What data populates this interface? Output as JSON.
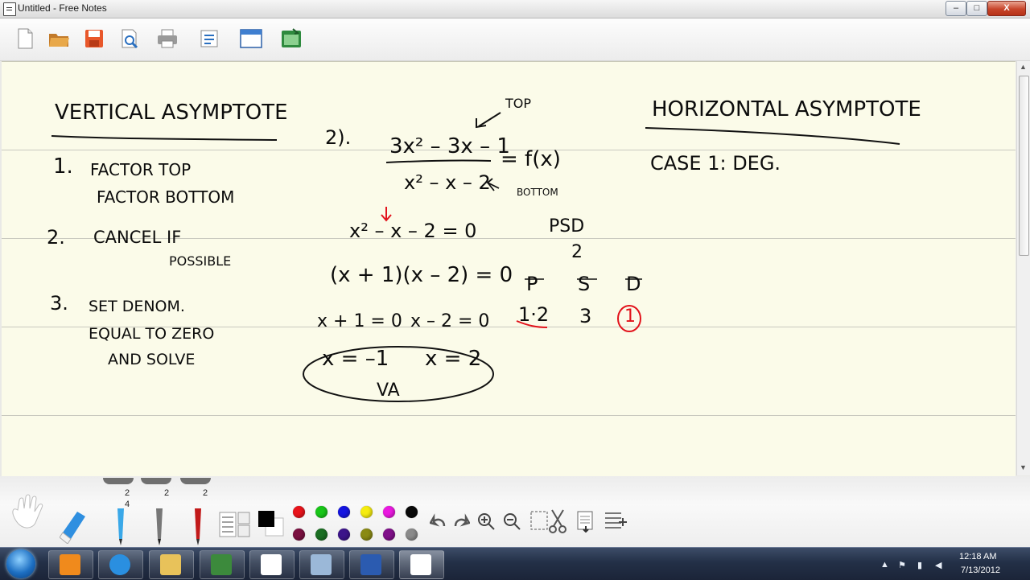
{
  "window": {
    "title": "Untitled - Free Notes",
    "controls": {
      "minimize": "–",
      "maximize": "□",
      "close": "X"
    }
  },
  "toolbar": {
    "buttons": [
      "new-document-icon",
      "open-folder-icon",
      "save-icon",
      "print-preview-icon",
      "print-icon",
      "page-setup-icon",
      "window-icon",
      "export-image-icon"
    ]
  },
  "notes": {
    "vertical": {
      "heading": "VERTICAL ASYMPTOTE",
      "step1_num": "1.",
      "step1_a": "FACTOR TOP",
      "step1_b": "FACTOR BOTTOM",
      "step2_num": "2.",
      "step2_a": "CANCEL IF",
      "step2_b": "POSSIBLE",
      "step3_num": "3.",
      "step3_a": "SET DENOM.",
      "step3_b": "EQUAL TO ZERO",
      "step3_c": "AND SOLVE"
    },
    "example": {
      "label": "2).",
      "numerator": "3x² – 3x – 1",
      "fx": "= f(x)",
      "denominator": "x² – x – 2",
      "top_label": "TOP",
      "bottom_label": "BOTTOM",
      "eq_set": "x² – x – 2 = 0",
      "factored": "(x + 1)(x – 2) = 0",
      "eq1": "x + 1 = 0",
      "eq2": "x – 2 = 0",
      "root1": "x = –1",
      "root2": "x = 2",
      "va_label": "VA"
    },
    "psd": {
      "title": "PSD",
      "sub": "2",
      "col_p": "P",
      "col_s": "S",
      "col_d": "D",
      "val_p": "1·2",
      "val_s": "3",
      "val_d": "1"
    },
    "horizontal": {
      "heading": "HORIZONTAL ASYMPTOTE",
      "case": "CASE 1:  DEG."
    }
  },
  "palette": {
    "pen_badges": [
      "2",
      "2",
      "2"
    ],
    "brush_badge": "4",
    "colors": [
      "#e8141b",
      "#19c619",
      "#1414e0",
      "#f5ec10",
      "#ea1ae0",
      "#0a0a0a",
      "#7a1040",
      "#1a6e22",
      "#3c148a",
      "#8a8a14",
      "#80108a",
      "#8a8a8a"
    ]
  },
  "taskbar": {
    "time": "12:18 AM",
    "date": "7/13/2012",
    "apps": [
      "media-player-icon",
      "internet-explorer-icon",
      "file-explorer-icon",
      "camtasia-icon",
      "free-notes-icon",
      "network-tool-icon",
      "word-icon",
      "free-notes-active-icon"
    ]
  }
}
